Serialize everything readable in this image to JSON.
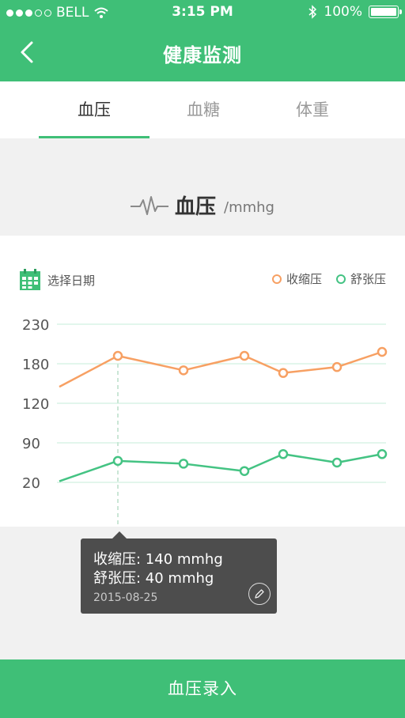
{
  "status_bar": {
    "carrier": "BELL",
    "time": "3:15 PM",
    "battery": "100%"
  },
  "nav": {
    "title": "健康监测"
  },
  "tabs": [
    {
      "label": "血压",
      "active": true
    },
    {
      "label": "血糖",
      "active": false
    },
    {
      "label": "体重",
      "active": false
    }
  ],
  "metric": {
    "name": "血压",
    "unit": "/mmhg"
  },
  "chart": {
    "date_picker_label": "选择日期"
  },
  "chart_data": {
    "type": "line",
    "y_tick_labels": [
      "230",
      "180",
      "120",
      "90",
      "20"
    ],
    "grid": true,
    "legend_position": "top-right",
    "series": [
      {
        "name": "收缩压",
        "color": "#f7a063",
        "values": [
          145,
          190,
          170,
          190,
          166,
          175,
          195
        ]
      },
      {
        "name": "舒张压",
        "color": "#44c383",
        "values": [
          22,
          58,
          53,
          40,
          70,
          55,
          70
        ]
      }
    ]
  },
  "tooltip": {
    "line1": "收缩压: 140 mmhg",
    "line2": "舒张压: 40 mmhg",
    "date": "2015-08-25"
  },
  "bottom_button": {
    "label": "血压录入"
  }
}
